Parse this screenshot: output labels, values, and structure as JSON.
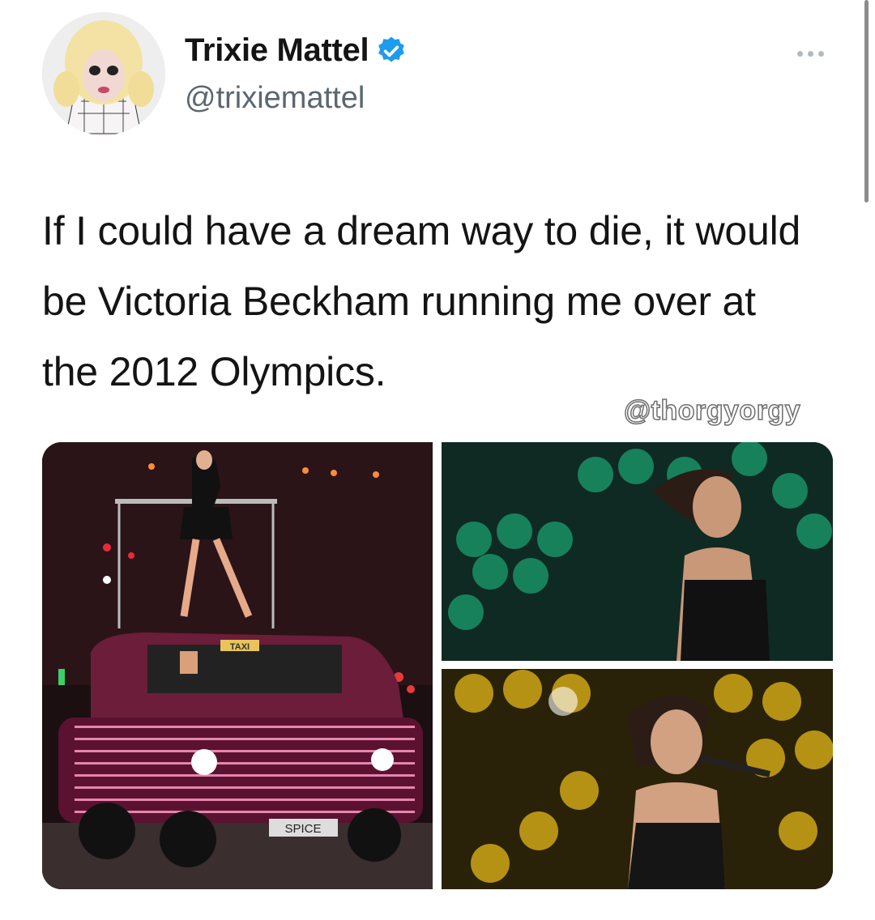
{
  "tweet": {
    "author_name": "Trixie Mattel",
    "handle": "@trixiemattel",
    "text": "If I could have a dream way to die, it would be Victoria Beckham running me over at the 2012 Olympics.",
    "watermark": "@thorgyorgy"
  },
  "media": {
    "taxi_sign": "TAXI",
    "plate": "SPICE"
  },
  "icons": {
    "verified": "verified-badge-icon",
    "more": "more-options-icon"
  },
  "colors": {
    "verified_blue": "#1d9bf0",
    "handle_gray": "#5b6670"
  }
}
